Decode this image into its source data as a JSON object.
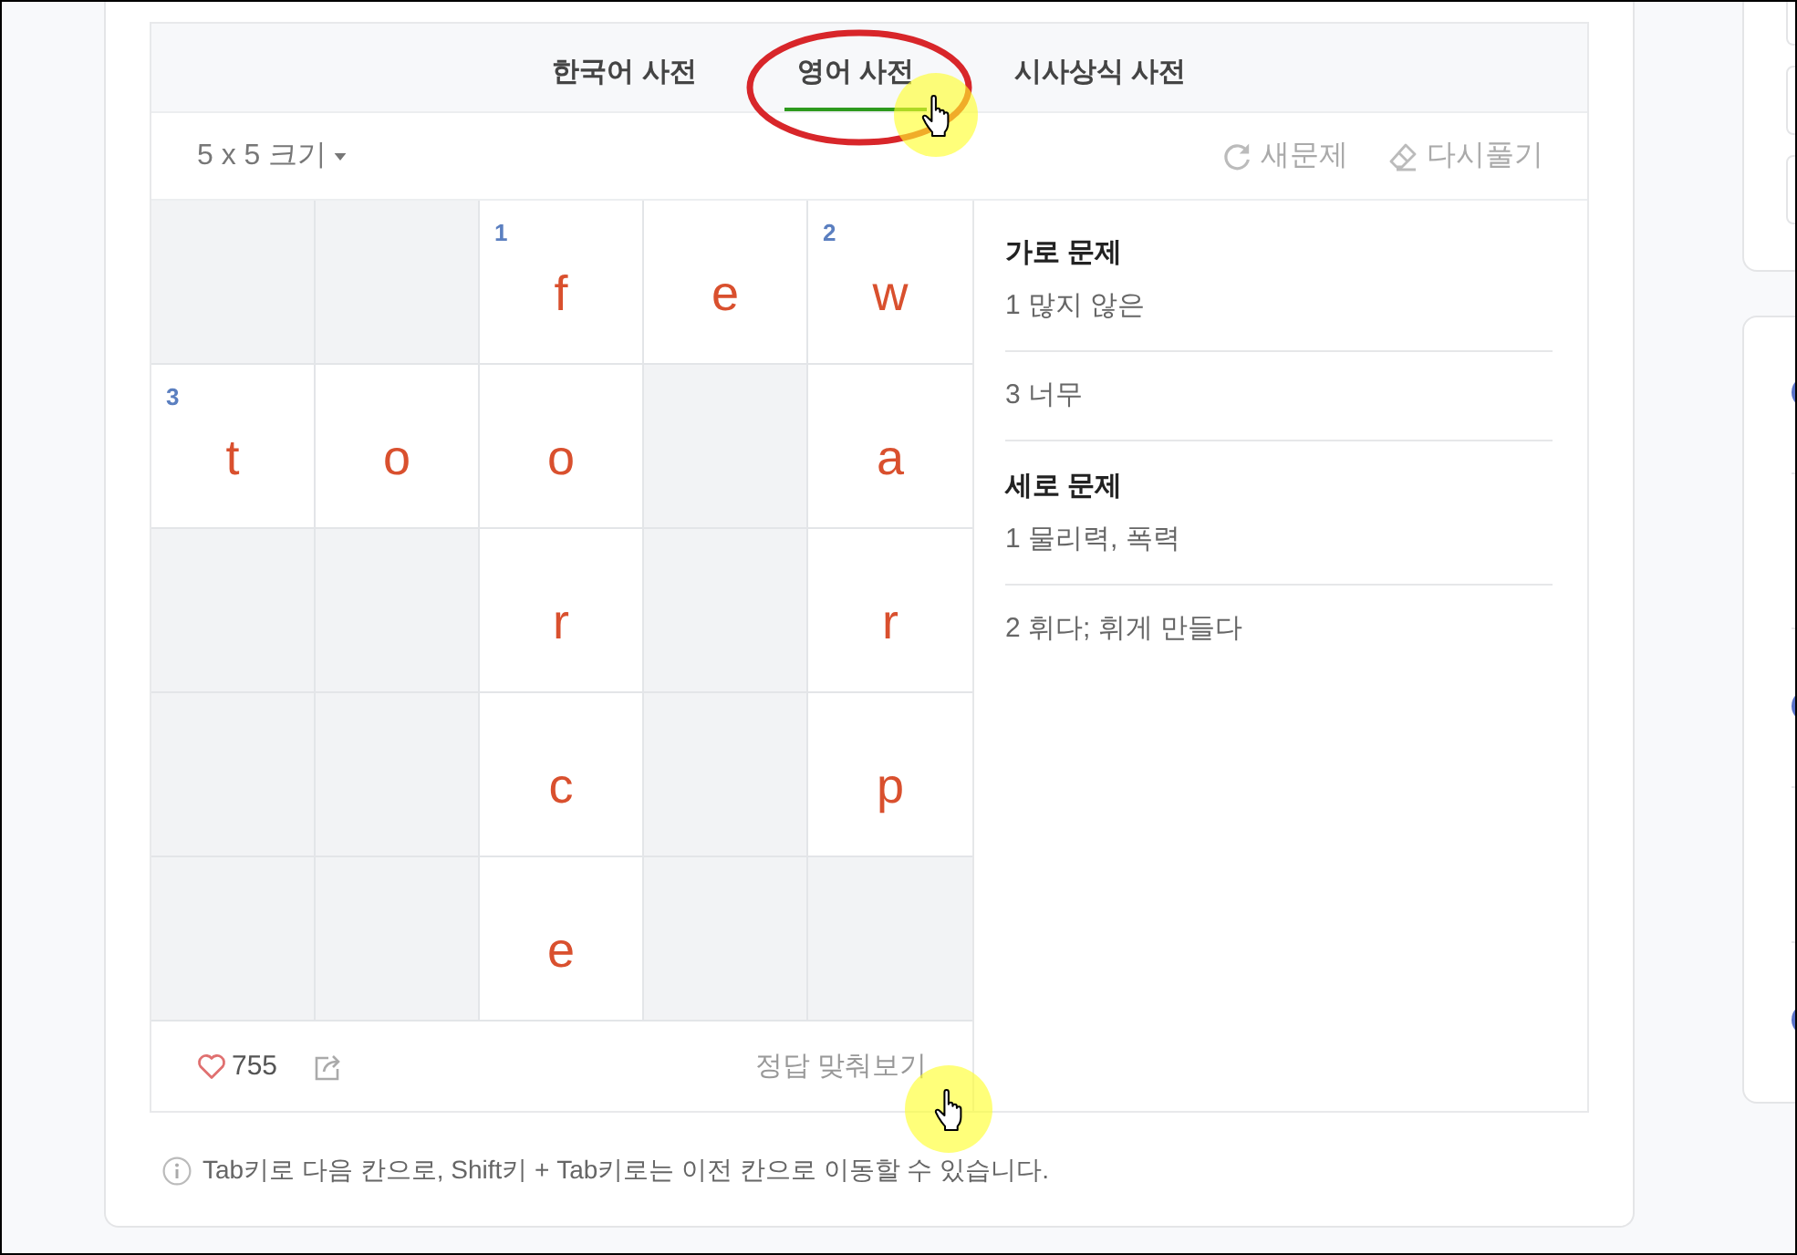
{
  "tabs": [
    {
      "label": "한국어 사전",
      "selected": false
    },
    {
      "label": "영어 사전",
      "selected": true
    },
    {
      "label": "시사상식 사전",
      "selected": false
    }
  ],
  "toolbar": {
    "size_menu": "5 x 5 크기",
    "actions": [
      {
        "kind": "new",
        "label": "새문제"
      },
      {
        "kind": "reset",
        "label": "다시풀기"
      }
    ]
  },
  "grid": {
    "rows": [
      [
        {
          "kind": "block"
        },
        {
          "kind": "block"
        },
        {
          "kind": "letter",
          "letter": "f",
          "number": "1"
        },
        {
          "kind": "letter",
          "letter": "e"
        },
        {
          "kind": "letter",
          "letter": "w",
          "number": "2"
        }
      ],
      [
        {
          "kind": "letter",
          "letter": "t",
          "number": "3"
        },
        {
          "kind": "letter",
          "letter": "o"
        },
        {
          "kind": "letter",
          "letter": "o"
        },
        {
          "kind": "block"
        },
        {
          "kind": "letter",
          "letter": "a"
        }
      ],
      [
        {
          "kind": "block"
        },
        {
          "kind": "block"
        },
        {
          "kind": "letter",
          "letter": "r"
        },
        {
          "kind": "block"
        },
        {
          "kind": "letter",
          "letter": "r"
        }
      ],
      [
        {
          "kind": "block"
        },
        {
          "kind": "block"
        },
        {
          "kind": "letter",
          "letter": "c"
        },
        {
          "kind": "block"
        },
        {
          "kind": "letter",
          "letter": "p"
        }
      ],
      [
        {
          "kind": "block"
        },
        {
          "kind": "block"
        },
        {
          "kind": "letter",
          "letter": "e"
        },
        {
          "kind": "block"
        },
        {
          "kind": "block"
        }
      ]
    ]
  },
  "clues": [
    {
      "title": "가로 문제",
      "items": [
        "1 많지 않은",
        "3 너무"
      ]
    },
    {
      "title": "세로 문제",
      "items": [
        "1 물리력, 폭력",
        "2 휘다; 휘게 만들다"
      ]
    }
  ],
  "footer": {
    "likes": "755",
    "check_button": "정답 맞춰보기"
  },
  "hint": "Tab키로 다음 칸으로, Shift키 + Tab키로는 이전 칸으로 이동할 수 있습니다."
}
